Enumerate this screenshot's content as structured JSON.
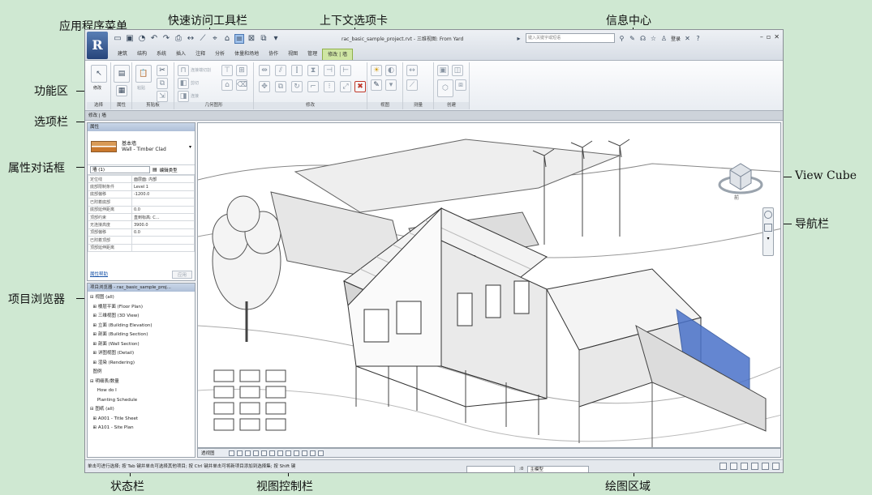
{
  "callouts": {
    "app_menu": "应用程序菜单",
    "quick_access": "快速访问工具栏",
    "context_tab": "上下文选项卡",
    "info_center": "信息中心",
    "ribbon": "功能区",
    "options_bar": "选项栏",
    "properties": "属性对话框",
    "project_browser": "项目浏览器",
    "view_cube": "View Cube",
    "nav_bar": "导航栏",
    "status_bar": "状态栏",
    "view_control": "视图控制栏",
    "drawing_area": "绘图区域"
  },
  "titlebar": {
    "title": "rac_basic_sample_project.rvt - 三维视图: From Yard",
    "search_placeholder": "键入关键字或短语",
    "login": "登录"
  },
  "tabs": [
    "建筑",
    "结构",
    "系统",
    "插入",
    "注释",
    "分析",
    "体量和场地",
    "协作",
    "视图",
    "管理",
    "修改 | 墙"
  ],
  "ribbon_panels": [
    {
      "label": "选择"
    },
    {
      "label": "属性"
    },
    {
      "label": "剪贴板"
    },
    {
      "label": "几何图形"
    },
    {
      "label": "修改"
    },
    {
      "label": "视图"
    },
    {
      "label": "测量"
    },
    {
      "label": "创建"
    }
  ],
  "ribbon_texts": {
    "modify": "修改",
    "paste": "粘贴",
    "cut_join": "连接端切割",
    "cut": "剪切",
    "join": "连接"
  },
  "options_bar": "修改 | 墙",
  "properties": {
    "header": "属性",
    "type_line1": "基本墙",
    "type_line2": "Wall - Timber Clad",
    "filter": "墙 (1)",
    "edit_type": "编辑类型",
    "rows": [
      {
        "k": "定位线",
        "v": "面层面: 内部"
      },
      {
        "k": "底部限制条件",
        "v": "Level 1"
      },
      {
        "k": "底部偏移",
        "v": "-1200.0"
      },
      {
        "k": "已附着底部",
        "v": ""
      },
      {
        "k": "底部延伸距离",
        "v": "0.0"
      },
      {
        "k": "顶部约束",
        "v": "直到标高: C..."
      },
      {
        "k": "无连接高度",
        "v": "3900.0"
      },
      {
        "k": "顶部偏移",
        "v": "0.0"
      },
      {
        "k": "已附着顶部",
        "v": ""
      },
      {
        "k": "顶部延伸距离",
        "v": ""
      }
    ],
    "help": "属性帮助",
    "apply": "应用"
  },
  "browser": {
    "header": "项目浏览器 - rac_basic_sample_proj...",
    "items": [
      "⊟ 视图 (all)",
      "  ⊞ 楼层平面 (Floor Plan)",
      "  ⊞ 三维视图 (3D View)",
      "  ⊞ 立面 (Building Elevation)",
      "  ⊞ 剖面 (Building Section)",
      "  ⊞ 剖面 (Wall Section)",
      "  ⊞ 详图视图 (Detail)",
      "  ⊞ 渲染 (Rendering)",
      "  图例",
      "⊟ 明细表/数量",
      "     How do I",
      "     Planting Schedule",
      "⊟ 图纸 (all)",
      "  ⊞ A001 - Title Sheet",
      "  ⊞ A101 - Site Plan"
    ]
  },
  "viewbar": {
    "scale": "透视图"
  },
  "statusbar": {
    "text": "单击可进行选择; 按 Tab 键并单击可选择其他项目; 按 Ctrl 键并单击可将新项目添加到选择集; 按 Shift 键",
    "model": ":0",
    "filter_box": "主模型"
  },
  "viewcube": {
    "label": "前"
  }
}
